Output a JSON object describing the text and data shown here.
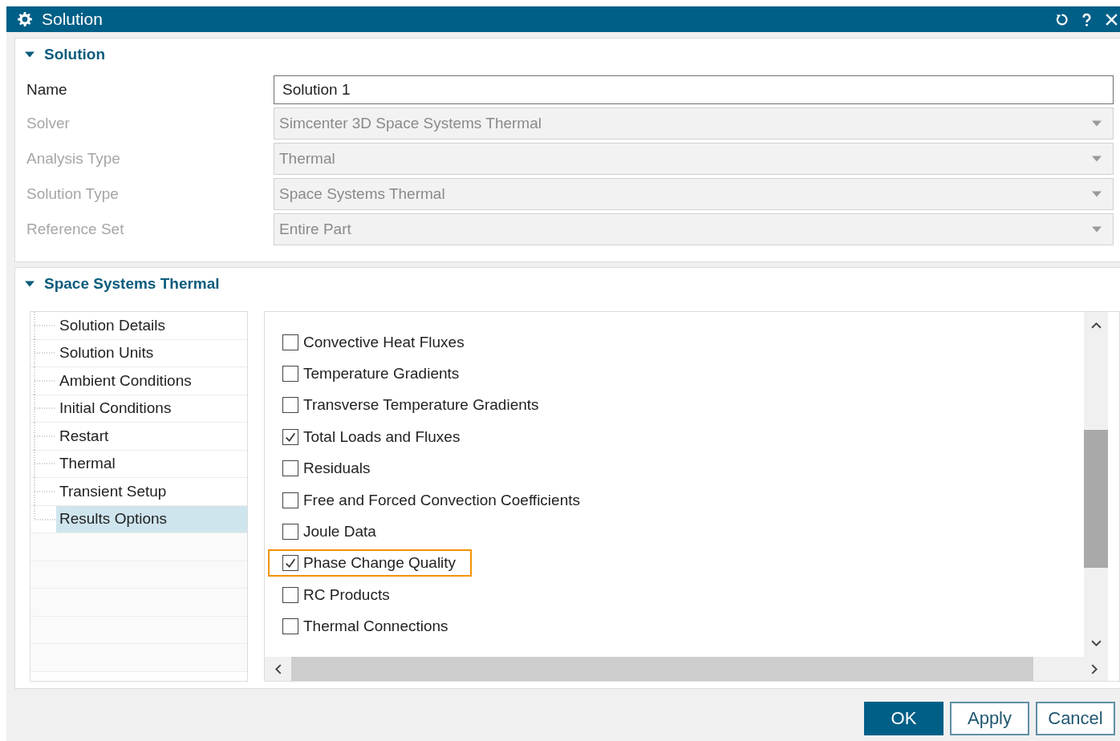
{
  "window": {
    "title": "Solution"
  },
  "solution_section": {
    "title": "Solution",
    "expanded": true,
    "fields": [
      {
        "label": "Name",
        "kind": "text",
        "value": "Solution 1",
        "disabled": false
      },
      {
        "label": "Solver",
        "kind": "dropdown",
        "value": "Simcenter 3D Space Systems Thermal",
        "disabled": true
      },
      {
        "label": "Analysis Type",
        "kind": "dropdown",
        "value": "Thermal",
        "disabled": true
      },
      {
        "label": "Solution Type",
        "kind": "dropdown",
        "value": "Space Systems Thermal",
        "disabled": true
      },
      {
        "label": "Reference Set",
        "kind": "dropdown",
        "value": "Entire Part",
        "disabled": true
      }
    ]
  },
  "thermal_section": {
    "title": "Space Systems Thermal",
    "expanded": true,
    "tree": [
      {
        "label": "Solution Details",
        "selected": false
      },
      {
        "label": "Solution Units",
        "selected": false
      },
      {
        "label": "Ambient Conditions",
        "selected": false
      },
      {
        "label": "Initial Conditions",
        "selected": false
      },
      {
        "label": "Restart",
        "selected": false
      },
      {
        "label": "Thermal",
        "selected": false
      },
      {
        "label": "Transient Setup",
        "selected": false
      },
      {
        "label": "Results Options",
        "selected": true
      }
    ],
    "options": [
      {
        "label": "Convective Heat Fluxes",
        "checked": false,
        "highlighted": false
      },
      {
        "label": "Temperature Gradients",
        "checked": false,
        "highlighted": false
      },
      {
        "label": "Transverse Temperature Gradients",
        "checked": false,
        "highlighted": false
      },
      {
        "label": "Total Loads and Fluxes",
        "checked": true,
        "highlighted": false
      },
      {
        "label": "Residuals",
        "checked": false,
        "highlighted": false
      },
      {
        "label": "Free and Forced Convection Coefficients",
        "checked": false,
        "highlighted": false
      },
      {
        "label": "Joule Data",
        "checked": false,
        "highlighted": false
      },
      {
        "label": "Phase Change Quality",
        "checked": true,
        "highlighted": true
      },
      {
        "label": "RC Products",
        "checked": false,
        "highlighted": false
      },
      {
        "label": "Thermal Connections",
        "checked": false,
        "highlighted": false
      }
    ]
  },
  "buttons": [
    {
      "label": "OK",
      "kind": "primary"
    },
    {
      "label": "Apply",
      "kind": "secondary"
    },
    {
      "label": "Cancel",
      "kind": "secondary"
    }
  ]
}
